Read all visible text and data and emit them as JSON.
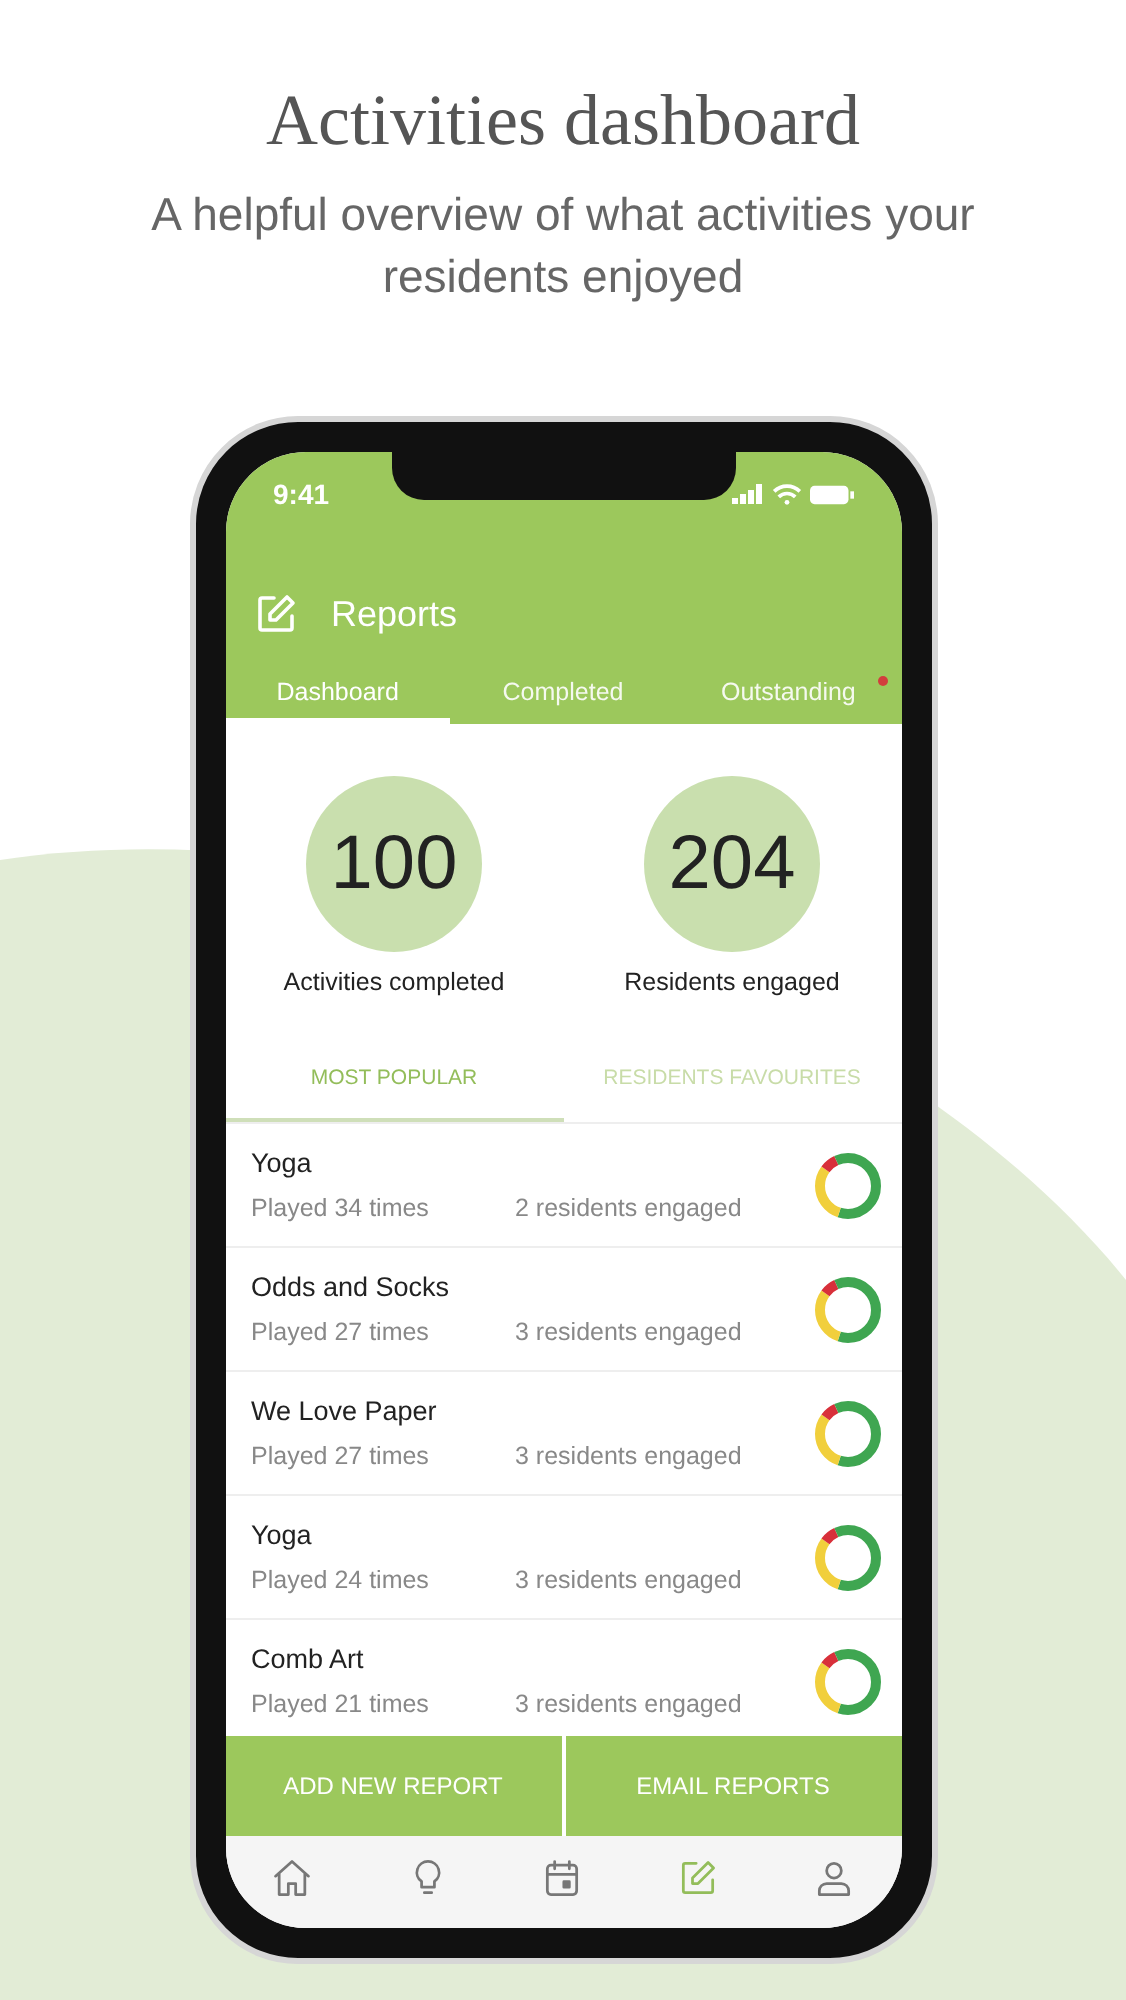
{
  "heading": "Activities dashboard",
  "subheading": "A helpful overview of what activities your residents enjoyed",
  "status_bar": {
    "time": "9:41"
  },
  "header": {
    "title": "Reports"
  },
  "tabs": [
    {
      "label": "Dashboard",
      "selected": true,
      "alert": false
    },
    {
      "label": "Completed",
      "selected": false,
      "alert": false
    },
    {
      "label": "Outstanding",
      "selected": false,
      "alert": true
    }
  ],
  "stats": [
    {
      "value": "100",
      "label": "Activities completed"
    },
    {
      "value": "204",
      "label": "Residents engaged"
    }
  ],
  "subtabs": [
    {
      "label": "MOST POPULAR",
      "selected": true
    },
    {
      "label": "RESIDENTS FAVOURITES",
      "selected": false
    }
  ],
  "activities": [
    {
      "name": "Yoga",
      "played": "Played 34 times",
      "engaged": "2 residents engaged"
    },
    {
      "name": "Odds and Socks",
      "played": "Played 27 times",
      "engaged": "3 residents engaged"
    },
    {
      "name": "We Love Paper",
      "played": "Played 27 times",
      "engaged": "3 residents engaged"
    },
    {
      "name": "Yoga",
      "played": "Played 24 times",
      "engaged": "3 residents engaged"
    },
    {
      "name": "Comb Art",
      "played": "Played 21 times",
      "engaged": "3 residents engaged"
    }
  ],
  "actions": [
    "ADD NEW REPORT",
    "EMAIL REPORTS"
  ],
  "nav": [
    {
      "kind": "home",
      "selected": false
    },
    {
      "kind": "bulb",
      "selected": false
    },
    {
      "kind": "calendar",
      "selected": false
    },
    {
      "kind": "edit",
      "selected": true
    },
    {
      "kind": "user",
      "selected": false
    }
  ]
}
